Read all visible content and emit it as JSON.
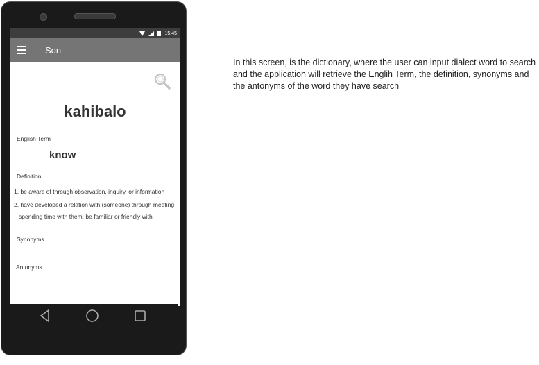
{
  "status": {
    "time": "15:45"
  },
  "appbar": {
    "title": "Son"
  },
  "search": {
    "value": "",
    "placeholder": ""
  },
  "entry": {
    "headword": "kahibalo",
    "english_term_label": "English Term",
    "english_term": "know",
    "definition_label": "Definition:",
    "definitions": [
      "1. be aware of through observation, inquiry, or information",
      "2. have developed a relation with (someone) through meeting",
      "spending time with them; be familiar or friendly with"
    ],
    "synonyms_label": "Synonyms",
    "antonyms_label": "Antonyms"
  },
  "description": "In this screen, is the dictionary, where the user can input dialect word to search and the application will retrieve the Englih Term, the definition, synonyms and the antonyms of the word they have search"
}
